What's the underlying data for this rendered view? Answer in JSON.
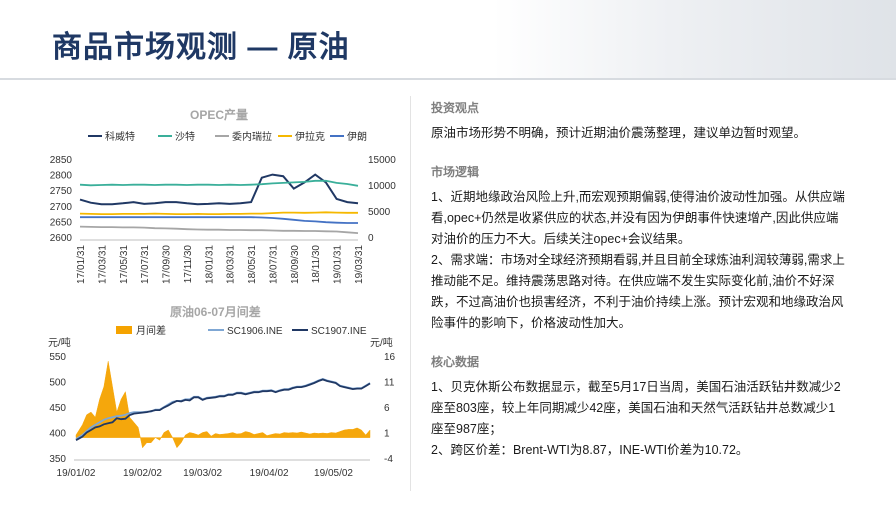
{
  "page": {
    "title": "商品市场观测 — 原油"
  },
  "chart_data": [
    {
      "type": "line",
      "title": "OPEC产量",
      "x": [
        "17/01/31",
        "17/02/28",
        "17/03/31",
        "17/04/30",
        "17/05/31",
        "17/06/30",
        "17/07/31",
        "17/08/31",
        "17/09/30",
        "17/10/31",
        "17/11/30",
        "17/12/31",
        "18/01/31",
        "18/02/28",
        "18/03/31",
        "18/04/30",
        "18/05/31",
        "18/06/30",
        "18/07/31",
        "18/08/31",
        "18/09/30",
        "18/10/31",
        "18/11/30",
        "18/12/31",
        "19/01/31",
        "19/02/28",
        "19/03/31"
      ],
      "x_tick_labels": [
        "17/01/31",
        "17/03/31",
        "17/05/31",
        "17/07/31",
        "17/09/30",
        "17/11/30",
        "18/01/31",
        "18/03/31",
        "18/05/31",
        "18/07/31",
        "18/09/30",
        "18/11/30",
        "19/01/31",
        "19/03/31"
      ],
      "y_left_ticks": [
        "2850",
        "2800",
        "2750",
        "2700",
        "2650",
        "2600"
      ],
      "y_right_ticks": [
        "15000",
        "10000",
        "5000",
        "0"
      ],
      "ylim_left": [
        2600,
        2850
      ],
      "ylim_right": [
        0,
        15000
      ],
      "legend_position": "top",
      "grid": false,
      "series": [
        {
          "name": "科威特",
          "axis": "left",
          "color": "#203864",
          "values": [
            2720,
            2710,
            2705,
            2705,
            2708,
            2712,
            2706,
            2708,
            2712,
            2712,
            2708,
            2705,
            2706,
            2708,
            2706,
            2708,
            2712,
            2790,
            2800,
            2795,
            2755,
            2775,
            2800,
            2775,
            2722,
            2712,
            2708
          ]
        },
        {
          "name": "沙特",
          "axis": "right",
          "color": "#3aaf9a",
          "values": [
            10050,
            9950,
            10000,
            10050,
            10000,
            10050,
            10050,
            10000,
            10050,
            10050,
            10000,
            10050,
            10050,
            10000,
            10050,
            10000,
            10050,
            10150,
            10300,
            10400,
            10500,
            10600,
            10800,
            10800,
            10400,
            10200,
            9850
          ]
        },
        {
          "name": "委内瑞拉",
          "axis": "right",
          "color": "#a6a6a6",
          "values": [
            2000,
            1950,
            1900,
            1900,
            1850,
            1850,
            1800,
            1700,
            1650,
            1600,
            1500,
            1450,
            1400,
            1400,
            1350,
            1350,
            1300,
            1300,
            1250,
            1200,
            1200,
            1150,
            1150,
            1100,
            1050,
            900,
            750
          ]
        },
        {
          "name": "伊拉克",
          "axis": "right",
          "color": "#f5b800",
          "values": [
            4500,
            4450,
            4400,
            4400,
            4450,
            4450,
            4450,
            4500,
            4450,
            4400,
            4400,
            4450,
            4400,
            4400,
            4450,
            4450,
            4500,
            4500,
            4600,
            4700,
            4700,
            4650,
            4700,
            4750,
            4700,
            4650,
            4650
          ]
        },
        {
          "name": "伊朗",
          "axis": "right",
          "color": "#4472c4",
          "values": [
            3800,
            3800,
            3800,
            3800,
            3800,
            3800,
            3800,
            3800,
            3800,
            3800,
            3800,
            3800,
            3800,
            3800,
            3800,
            3800,
            3800,
            3750,
            3650,
            3500,
            3300,
            3100,
            3000,
            2850,
            2750,
            2700,
            2700
          ]
        }
      ]
    },
    {
      "type": "line",
      "title": "原油06-07月间差",
      "y_left_label": "元/吨",
      "y_right_label": "元/吨",
      "x_tick_labels": [
        "19/01/02",
        "19/02/02",
        "19/03/02",
        "19/04/02",
        "19/05/02"
      ],
      "x_tick_days": [
        0,
        31,
        59,
        90,
        120
      ],
      "y_left_ticks": [
        "550",
        "500",
        "450",
        "400",
        "350"
      ],
      "y_right_ticks": [
        "16",
        "11",
        "6",
        "1",
        "-4"
      ],
      "ylim_left": [
        350,
        550
      ],
      "ylim_right": [
        -4,
        16
      ],
      "legend_position": "top",
      "grid": false,
      "x_days": [
        0,
        3,
        5,
        7,
        9,
        11,
        13,
        15,
        17,
        19,
        21,
        23,
        25,
        27,
        29,
        31,
        33,
        35,
        37,
        39,
        41,
        43,
        45,
        47,
        49,
        51,
        53,
        55,
        57,
        59,
        61,
        63,
        65,
        67,
        69,
        71,
        73,
        75,
        77,
        79,
        81,
        83,
        85,
        87,
        89,
        91,
        93,
        95,
        97,
        99,
        101,
        103,
        105,
        107,
        109,
        111,
        113,
        115,
        117,
        119,
        121,
        123,
        125,
        127,
        129,
        131,
        133,
        135,
        137
      ],
      "series": [
        {
          "name": "月间差",
          "type": "area",
          "axis": "right",
          "color": "#f5a300",
          "values": [
            0.5,
            2.5,
            4.5,
            5,
            4,
            7.5,
            10,
            15,
            10,
            5,
            7.5,
            9,
            4,
            3,
            2,
            -2,
            -1,
            -1,
            0,
            -0.5,
            1,
            1.5,
            0,
            -2,
            -1,
            0.5,
            1,
            0.8,
            0.5,
            1,
            1.2,
            0.3,
            0.8,
            0.6,
            0.7,
            0.8,
            1,
            0.7,
            0.8,
            1.2,
            1,
            0.6,
            0.8,
            1,
            0.4,
            0.6,
            0.8,
            0.7,
            1,
            0.9,
            1,
            0.9,
            1.1,
            0.9,
            0.7,
            0.9,
            0.8,
            0.9,
            0.8,
            1,
            0.9,
            1.2,
            1.5,
            1.6,
            1.6,
            1.9,
            1.5,
            0.5,
            1.5
          ]
        },
        {
          "name": "SC1906.INE",
          "axis": "left",
          "color": "#7fa7d4",
          "values": [
            387,
            395,
            403,
            410,
            415,
            420,
            425,
            428,
            430,
            432,
            433,
            435,
            438,
            440,
            440,
            440,
            441,
            441,
            445,
            445,
            450,
            455,
            460,
            462,
            462,
            465,
            465,
            470,
            470,
            465,
            468,
            469,
            470,
            472,
            472,
            475,
            475,
            478,
            478,
            476,
            478,
            480,
            480,
            482,
            482,
            483,
            480,
            483,
            485,
            485,
            488,
            490,
            490,
            492,
            495,
            498,
            502,
            505,
            502,
            500,
            498,
            492,
            490,
            488,
            486,
            487,
            487,
            492,
            497
          ]
        },
        {
          "name": "SC1907.INE",
          "axis": "left",
          "color": "#203864",
          "values": [
            385,
            392,
            400,
            405,
            410,
            412,
            416,
            418,
            420,
            428,
            426,
            427,
            434,
            437,
            438,
            439,
            440,
            442,
            444,
            444,
            449,
            453,
            458,
            462,
            461,
            464,
            463,
            469,
            469,
            464,
            467,
            468,
            469,
            471,
            471,
            474,
            474,
            477,
            477,
            475,
            477,
            479,
            479,
            481,
            481,
            482,
            479,
            482,
            484,
            484,
            487,
            489,
            489,
            491,
            494,
            497,
            501,
            504,
            501,
            499,
            497,
            491,
            489,
            487,
            485,
            486,
            486,
            491,
            496
          ]
        }
      ]
    }
  ],
  "right": {
    "s1": {
      "title": "投资观点",
      "p1": "原油市场形势不明确，预计近期油价震荡整理，建议单边暂时观望。"
    },
    "s2": {
      "title": "市场逻辑",
      "p1": "1、近期地缘政治风险上升,而宏观预期偏弱,使得油价波动性加强。从供应端看,opec+仍然是收紧供应的状态,并没有因为伊朗事件快速增产,因此供应端对油价的压力不大。后续关注opec+会议结果。",
      "p2": "2、需求端：市场对全球经济预期看弱,并且目前全球炼油利润较薄弱,需求上推动能不足。维持震荡思路对待。在供应端不发生实际变化前,油价不好深跌，不过高油价也损害经济，不利于油价持续上涨。预计宏观和地缘政治风险事件的影响下，价格波动性加大。"
    },
    "s3": {
      "title": "核心数据",
      "p1": "1、贝克休斯公布数据显示，截至5月17日当周，美国石油活跃钻井数减少2座至803座，较上年同期减少42座，美国石油和天然气活跃钻井总数减少1座至987座；",
      "p2": "2、跨区价差：Brent-WTI为8.87，INE-WTI价差为10.72。"
    }
  }
}
